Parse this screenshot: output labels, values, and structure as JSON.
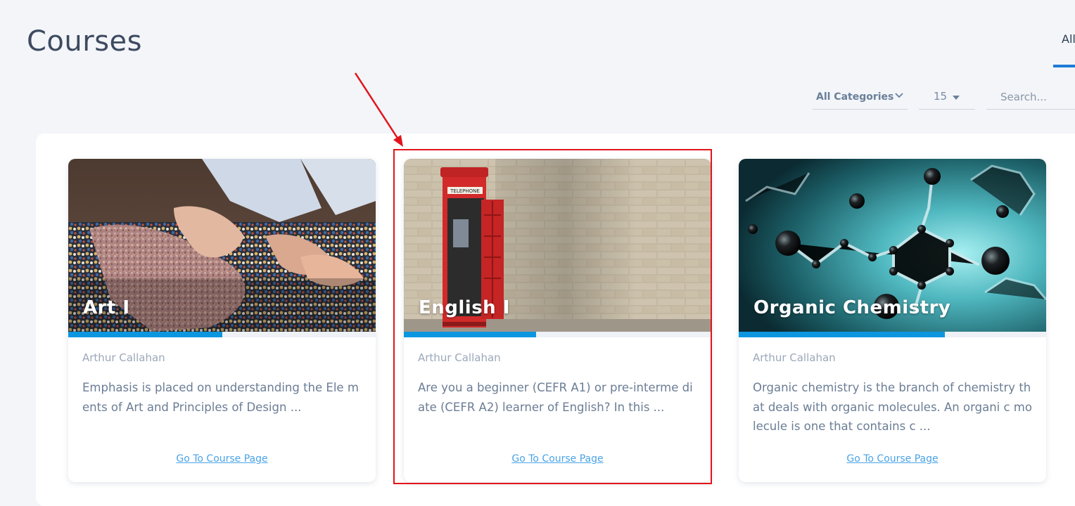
{
  "page": {
    "title": "Courses"
  },
  "tabs": [
    {
      "label": "All",
      "active": true
    }
  ],
  "filters": {
    "category": "All Categories",
    "per_page": "15",
    "search_placeholder": "Search..."
  },
  "courses": [
    {
      "title": "Art I",
      "author": "Arthur Callahan",
      "description": "Emphasis is placed on understanding the Ele ments of Art and Principles of Design ...",
      "link": "Go To Course Page",
      "progress": 0.5
    },
    {
      "title": "English I",
      "author": "Arthur Callahan",
      "description": "Are you a beginner (CEFR A1) or pre-interme diate (CEFR A2) learner of English? In this ...",
      "link": "Go To Course Page",
      "progress": 0.43
    },
    {
      "title": "Organic Chemistry",
      "author": "Arthur Callahan",
      "description": "Organic chemistry is the branch of chemistry that deals with organic molecules. An organi c molecule is one that contains c ...",
      "link": "Go To Course Page",
      "progress": 0.67
    }
  ],
  "colors": {
    "accent": "#1f7ad6",
    "progress": "#0d96e0",
    "annotation": "#e2141b"
  }
}
